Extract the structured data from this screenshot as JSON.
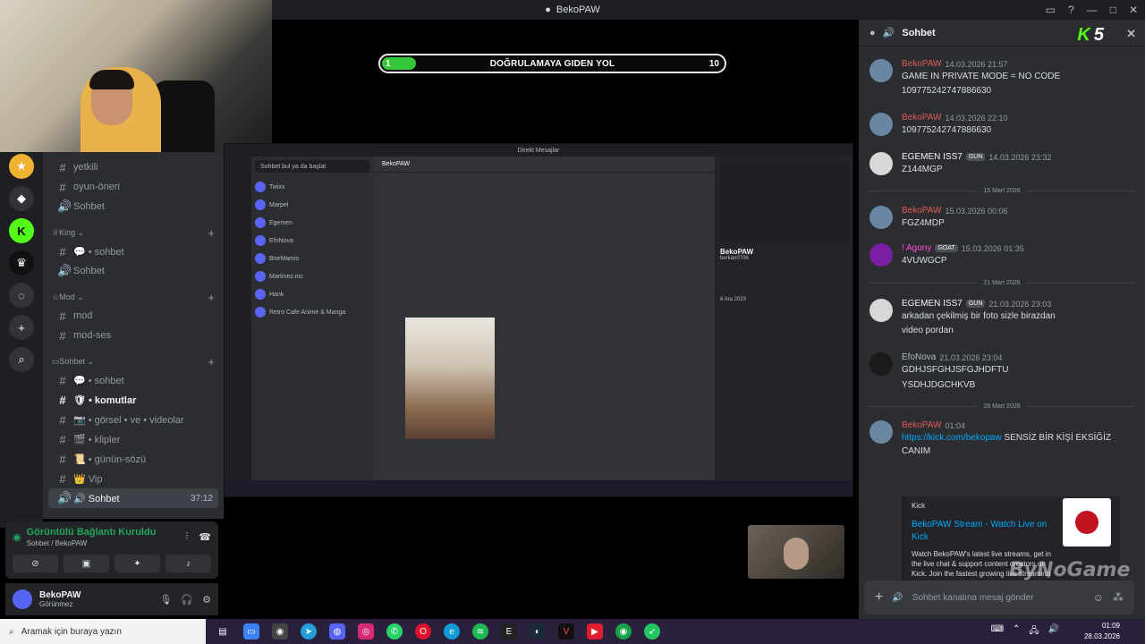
{
  "window": {
    "title": "BekoPAW",
    "controls": [
      "▭",
      "?",
      "—",
      "□",
      "✕"
    ]
  },
  "progress": {
    "start": "1",
    "label": "DOĞRULAMAYA GIDEN YOL",
    "end": "10",
    "fraction": 0.1
  },
  "sidebar": {
    "channels_top": [
      {
        "icon": "#",
        "label": "yetkili"
      },
      {
        "icon": "#",
        "label": "oyun-öneri"
      },
      {
        "icon": "🔊",
        "label": "Sohbet"
      }
    ],
    "cat_king": {
      "label": "King",
      "items": [
        {
          "icon": "#",
          "label": "💬 • sohbet"
        },
        {
          "icon": "🔊",
          "label": "Sohbet"
        }
      ]
    },
    "cat_mod": {
      "label": "Mod",
      "items": [
        {
          "icon": "#",
          "label": "mod"
        },
        {
          "icon": "#",
          "label": "mod-ses"
        }
      ]
    },
    "cat_sohbet": {
      "label": "Sohbet",
      "items": [
        {
          "icon": "#",
          "label": "💬 • sohbet"
        },
        {
          "icon": "#",
          "label": "🛡 • komutlar"
        },
        {
          "icon": "#",
          "label": "📷 • görsel • ve • videolar"
        },
        {
          "icon": "#",
          "label": "🎬 • klipler"
        },
        {
          "icon": "#",
          "label": "📜 • günün-sözü"
        },
        {
          "icon": "#",
          "label": "👑 Vip"
        },
        {
          "icon": "🔊",
          "label": "🔊 Sohbet",
          "time": "37:12"
        }
      ]
    }
  },
  "voice": {
    "status": "Görüntülü Bağlantı Kuruldu",
    "channel": "Sohbet / BekoPAW"
  },
  "user": {
    "name": "BekoPAW",
    "status": "Görünmez"
  },
  "share": {
    "title": "Direkt Mesajlar",
    "search": "Sohbet bul ya da başlat",
    "dm_list": [
      "Twixx",
      "Marpel",
      "Egemen",
      "EfoNova",
      "BneMamis",
      "Martinez.inc",
      "Hank",
      "Retro Cafe Anime & Manga"
    ],
    "chat_header": "BekoPAW",
    "profile_name": "BekoPAW",
    "profile_handle": "berkan0706",
    "profile_date": "6 Ara 2023"
  },
  "chat": {
    "header": "Sohbet",
    "kick_count": "5",
    "messages": [
      {
        "name": "BekoPAW",
        "time": "14.03.2026 21:57",
        "lines": [
          "GAME IN PRIVATE MODE = NO CODE",
          "109775242747886630"
        ]
      },
      {
        "name": "BekoPAW",
        "time": "14.03.2026 22:10",
        "lines": [
          "109775242747886630"
        ]
      },
      {
        "name": "EGEMEN ISS7",
        "tag": "GUN",
        "time": "14.03.2026 23:32",
        "lines": [
          "Z144MGP"
        ]
      },
      {
        "name": "BekoPAW",
        "time": "15.03.2026 00:06",
        "lines": [
          "FGZ4MDP"
        ]
      },
      {
        "name": "! Agony",
        "tag": "GOAT",
        "time": "15.03.2026 01:35",
        "lines": [
          "4VUWGCP"
        ]
      },
      {
        "name": "EGEMEN ISS7",
        "tag": "GUN",
        "time": "21.03.2026 23:03",
        "lines": [
          "arkadan çekilmiş bir foto sizle birazdan",
          "video pordan"
        ]
      },
      {
        "name": "EfoNova",
        "time": "21.03.2026 23:04",
        "lines": [
          "GDHJSFGHJSFGJHDFTU",
          "YSDHJDGCHKVB"
        ]
      },
      {
        "name": "BekoPAW",
        "time": "01:04",
        "link": "https://kick.com/bekopaw",
        "after_link": " SENSİZ BİR KİŞİ EKSİĞİZ",
        "line2": "CANIM"
      }
    ],
    "dividers": [
      "15 Mart 2026",
      "21 Mart 2026",
      "28 Mart 2026"
    ],
    "embed": {
      "provider": "Kick",
      "title": "BekoPAW Stream - Watch Live on Kick",
      "description": "Watch BekoPAW's latest live streams, get in the live chat & support content creators on Kick. Join the fastest growing live streaming community!"
    },
    "input_placeholder": "Sohbet kanalına mesaj gönder"
  },
  "watermark": "ByNoGame",
  "taskbar": {
    "search_placeholder": "Aramak için buraya yazın",
    "time": "01:09",
    "date": "28.03.2026"
  }
}
